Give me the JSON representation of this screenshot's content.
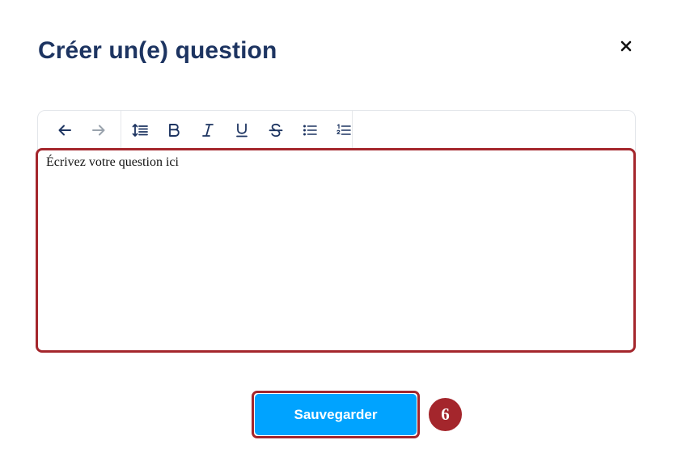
{
  "modal": {
    "title": "Créer un(e) question",
    "close_icon": "close-icon"
  },
  "editor": {
    "toolbar": {
      "history": [
        {
          "name": "undo",
          "icon": "arrow-left-icon",
          "enabled": true
        },
        {
          "name": "redo",
          "icon": "arrow-right-icon",
          "enabled": false
        }
      ],
      "format": [
        {
          "name": "line-height",
          "icon": "line-height-icon"
        },
        {
          "name": "bold",
          "icon": "bold-icon"
        },
        {
          "name": "italic",
          "icon": "italic-icon"
        },
        {
          "name": "underline",
          "icon": "underline-icon"
        },
        {
          "name": "strikethrough",
          "icon": "strikethrough-icon"
        },
        {
          "name": "bullet-list",
          "icon": "bullet-list-icon"
        },
        {
          "name": "numbered-list",
          "icon": "numbered-list-icon"
        }
      ]
    },
    "content": "Écrivez votre question ici"
  },
  "actions": {
    "save_label": "Sauvegarder"
  },
  "annotation": {
    "step_number": "6",
    "highlight_color": "#a4262c"
  },
  "colors": {
    "title": "#1d3461",
    "primary_button": "#00a3ff",
    "highlight": "#a4262c"
  }
}
